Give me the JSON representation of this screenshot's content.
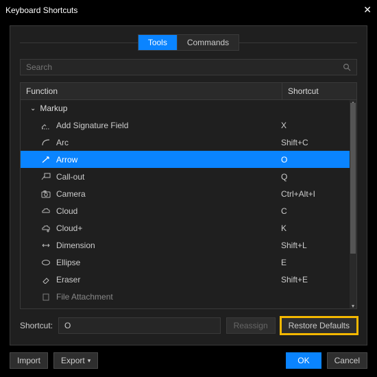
{
  "title": "Keyboard Shortcuts",
  "tabs": {
    "tools": "Tools",
    "commands": "Commands"
  },
  "search": {
    "placeholder": "Search"
  },
  "columns": {
    "function": "Function",
    "shortcut": "Shortcut"
  },
  "group": {
    "name": "Markup"
  },
  "rows": [
    {
      "label": "Add Signature Field",
      "shortcut": "X"
    },
    {
      "label": "Arc",
      "shortcut": "Shift+C"
    },
    {
      "label": "Arrow",
      "shortcut": "O"
    },
    {
      "label": "Call-out",
      "shortcut": "Q"
    },
    {
      "label": "Camera",
      "shortcut": "Ctrl+Alt+I"
    },
    {
      "label": "Cloud",
      "shortcut": "C"
    },
    {
      "label": "Cloud+",
      "shortcut": "K"
    },
    {
      "label": "Dimension",
      "shortcut": "Shift+L"
    },
    {
      "label": "Ellipse",
      "shortcut": "E"
    },
    {
      "label": "Eraser",
      "shortcut": "Shift+E"
    },
    {
      "label": "File Attachment",
      "shortcut": ""
    }
  ],
  "shortcutEdit": {
    "label": "Shortcut:",
    "value": "O"
  },
  "buttons": {
    "reassign": "Reassign",
    "restore": "Restore Defaults",
    "import": "Import",
    "export": "Export",
    "ok": "OK",
    "cancel": "Cancel"
  }
}
